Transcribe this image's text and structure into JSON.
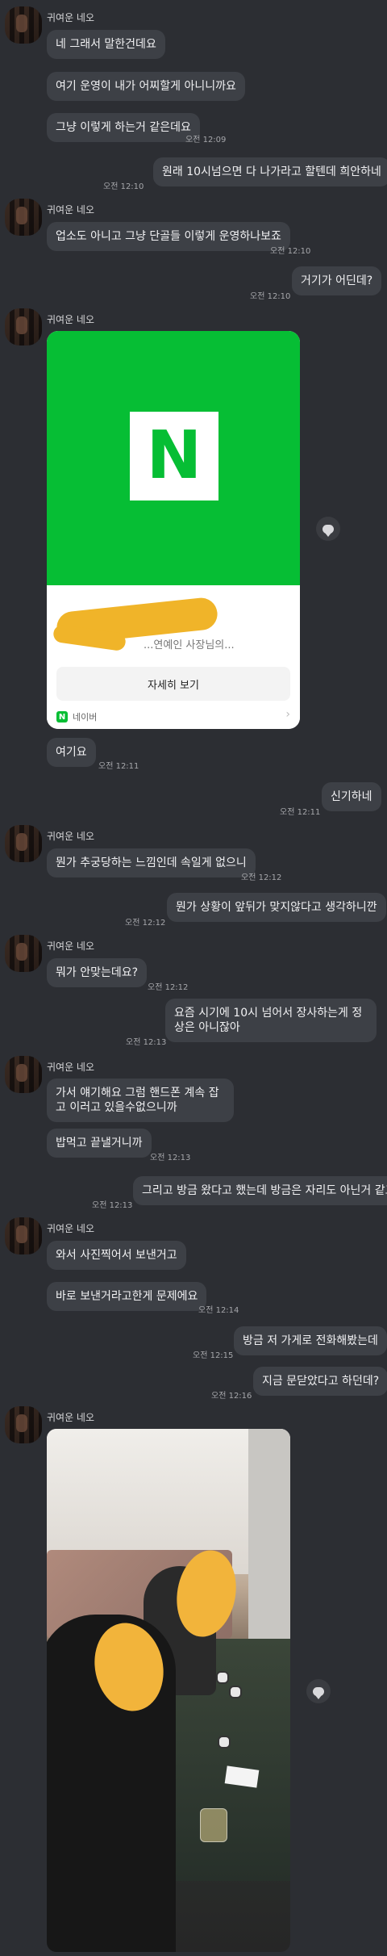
{
  "contact": {
    "name": "귀여운 네오"
  },
  "messages": {
    "m1": "네 그래서 말한건데요",
    "m2": "여기 운영이 내가 어찌할게 아니니까요",
    "m3": "그냥 이렇게 하는거 같은데요",
    "t1": "오전 12:09",
    "m4": "원래 10시넘으면 다 나가라고 할텐데 희안하네",
    "t2": "오전 12:10",
    "m5": "업소도 아니고 그냥 단골들 이렇게 운영하나보죠",
    "t3": "오전 12:10",
    "m6": "거기가 어딘데?",
    "t4": "오전 12:10",
    "m7": "여기요",
    "t5": "오전 12:11",
    "m8": "신기하네",
    "t6": "오전 12:11",
    "m9": "뭔가 추궁당하는 느낌인데 속일게 없으니",
    "t7": "오전 12:12",
    "m10": "뭔가 상황이 앞뒤가 맞지않다고 생각하니깐",
    "t8": "오전 12:12",
    "m11": "뭐가 안맞는데요?",
    "t9": "오전 12:12",
    "m12": "요즘 시기에 10시 넘어서 장사하는게 정상은 아니잖아",
    "t10": "오전 12:13",
    "m13": "가서 얘기해요 그럼 핸드폰 계속 잡고 이러고 있을수없으니까",
    "m14": "밥먹고 끝낼거니까",
    "t11": "오전 12:13",
    "m15": "그리고 방금 왔다고 했는데 방금은 자리도 아닌거 같고",
    "t12": "오전 12:13",
    "m16": "와서 사진찍어서 보낸거고",
    "m17": "바로 보낸거라고한게 문제에요",
    "t13": "오전 12:14",
    "m18": "방금 저 가게로 전화해봤는데",
    "t14": "오전 12:15",
    "m19": "지금 문닫았다고 하던데?",
    "t15": "오전 12:16"
  },
  "card": {
    "brand_letter": "N",
    "subtitle": "...연예인 사장님의...",
    "button": "자세히 보기",
    "footer": "네이버",
    "arrow": "›",
    "brand_color": "#06be34"
  },
  "icons": {
    "share": "share-bubble-icon"
  }
}
